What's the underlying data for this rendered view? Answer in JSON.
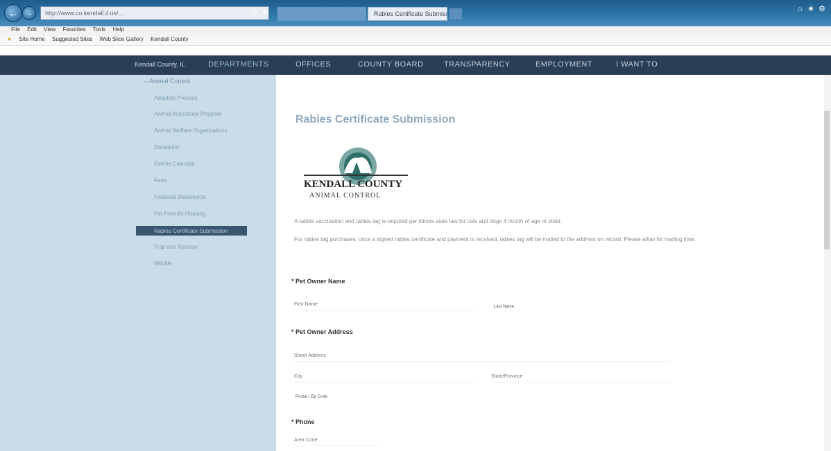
{
  "browser": {
    "address_text": "http://www.co.kendall.il.us/...",
    "tabs": [
      "",
      "Rabies Certificate Submiss..."
    ],
    "menu": [
      "File",
      "Edit",
      "View",
      "Favorites",
      "Tools",
      "Help"
    ],
    "favorites": [
      "Site Home",
      "Suggested Sites",
      "Web Slice Gallery",
      "Kendall County"
    ]
  },
  "site_nav": {
    "brand": "Kendall County, IL",
    "items": [
      "DEPARTMENTS",
      "OFFICES",
      "COUNTY BOARD",
      "TRANSPARENCY",
      "EMPLOYMENT",
      "I WANT TO"
    ],
    "active_index": 0
  },
  "sidebar": {
    "heading": "– Animal Control",
    "items": [
      "Adoption Process",
      "Animal Assistance Program",
      "Animal Welfare Organizations",
      "Donations",
      "Events Calendar",
      "Fees",
      "Financial Statements",
      "Pet Friendly Housing",
      "Rabies Certificate Submission",
      "Trap and Release",
      "Wildlife"
    ],
    "active_index": 8
  },
  "content": {
    "title": "Rabies Certificate Submission",
    "logo": {
      "line1": "KENDALL COUNTY",
      "line2": "ANIMAL CONTROL"
    },
    "para1": "A rabies vaccination and rabies tag is required per Illinois state law for cats and dogs 4 month of age or older.",
    "para2": "For rabies tag purchases, once a signed rabies certificate and payment is received, rabies tag will be mailed to the address on record. Please allow for mailing time.",
    "form": {
      "owner_name_label": "* Pet Owner Name",
      "first_placeholder": "First Name",
      "last_label": "Last Name",
      "address_label": "* Pet Owner Address",
      "street_placeholder": "Street Address",
      "city_placeholder": "City",
      "state_placeholder": "State/Province",
      "zip_label": "Postal / Zip Code",
      "phone_label": "* Phone",
      "phone_placeholder": "Area Code"
    }
  },
  "colors": {
    "nav_bg": "#2a3f55",
    "sidebar_bg": "#c9dce8",
    "sidebar_active": "#3a566f",
    "title_color": "#8faac0"
  }
}
